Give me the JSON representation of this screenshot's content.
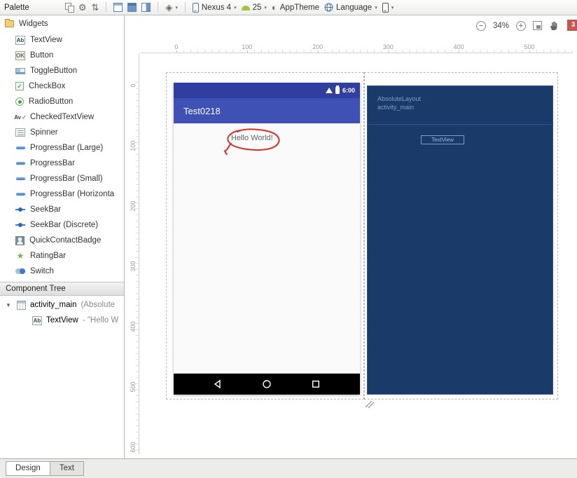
{
  "toolbar": {
    "palette_label": "Palette",
    "device_label": "Nexus 4",
    "api_label": "25",
    "theme_label": "AppTheme",
    "language_label": "Language"
  },
  "zoom_controls": {
    "zoom_level": "34%",
    "badge_count": "3"
  },
  "icons": {
    "caret": "▾",
    "gear": "⚙",
    "sort": "⇅",
    "diamond": "◈",
    "half_circle": "◐",
    "minus": "−",
    "plus": "+",
    "expander": "▼"
  },
  "palette": {
    "group_label": "Widgets",
    "items": [
      {
        "label": "TextView",
        "icon": "ab",
        "glyph": "Ab",
        "name": "textview-icon"
      },
      {
        "label": "Button",
        "icon": "ok",
        "glyph": "OK",
        "name": "button-icon"
      },
      {
        "label": "ToggleButton",
        "icon": "toggle",
        "glyph": "",
        "name": "togglebutton-icon"
      },
      {
        "label": "CheckBox",
        "icon": "checkbox",
        "glyph": "✓",
        "name": "checkbox-icon"
      },
      {
        "label": "RadioButton",
        "icon": "radio",
        "glyph": "",
        "name": "radiobutton-icon"
      },
      {
        "label": "CheckedTextView",
        "icon": "av",
        "glyph": "Av",
        "name": "checkedtextview-icon"
      },
      {
        "label": "Spinner",
        "icon": "spinner",
        "glyph": "",
        "name": "spinner-icon"
      },
      {
        "label": "ProgressBar (Large)",
        "icon": "progress",
        "glyph": "",
        "name": "progressbar-large-icon"
      },
      {
        "label": "ProgressBar",
        "icon": "progress",
        "glyph": "",
        "name": "progressbar-icon"
      },
      {
        "label": "ProgressBar (Small)",
        "icon": "progress",
        "glyph": "",
        "name": "progressbar-small-icon"
      },
      {
        "label": "ProgressBar (Horizonta",
        "icon": "progress",
        "glyph": "",
        "name": "progressbar-horizontal-icon"
      },
      {
        "label": "SeekBar",
        "icon": "seekbar",
        "glyph": "",
        "name": "seekbar-icon"
      },
      {
        "label": "SeekBar (Discrete)",
        "icon": "seekbar",
        "glyph": "",
        "name": "seekbar-discrete-icon"
      },
      {
        "label": "QuickContactBadge",
        "icon": "contact",
        "glyph": "",
        "name": "quickcontactbadge-icon"
      },
      {
        "label": "RatingBar",
        "icon": "rating",
        "glyph": "★",
        "name": "ratingbar-icon"
      },
      {
        "label": "Switch",
        "icon": "switch",
        "glyph": "",
        "name": "switch-icon"
      }
    ]
  },
  "component_tree": {
    "title": "Component Tree",
    "root_label": "activity_main",
    "root_suffix": "(Absolute",
    "child_label": "TextView",
    "child_suffix": "- \"Hello W"
  },
  "rulers": {
    "h": [
      "0",
      "100",
      "200",
      "300",
      "400",
      "500"
    ],
    "v": [
      "0",
      "100",
      "200",
      "300",
      "400",
      "500",
      "600"
    ]
  },
  "design": {
    "status_time": "6:00",
    "app_title": "Test0218",
    "hello_text": "Hello World!"
  },
  "blueprint": {
    "layout_label": "AbsoluteLayout",
    "id_label": "activity_main",
    "textview_label": "TextView"
  },
  "bottom_tabs": {
    "design": "Design",
    "text": "Text"
  },
  "colors": {
    "status_bar": "#303f9f",
    "app_bar": "#3f51b5",
    "blueprint_bg": "#1a3a69",
    "blueprint_line": "#7d9dc9",
    "annotation": "#d93025",
    "badge": "#c75450"
  }
}
